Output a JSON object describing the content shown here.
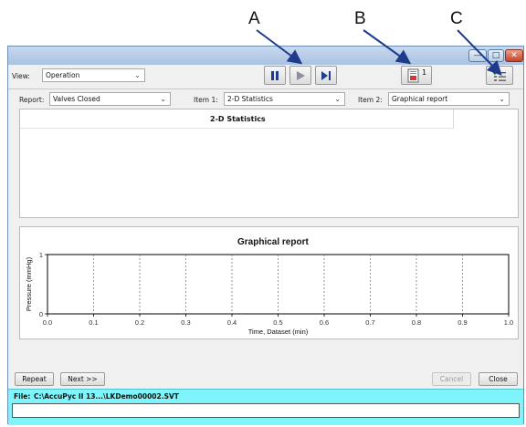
{
  "callouts": {
    "a": "A",
    "b": "B",
    "c": "C"
  },
  "window": {
    "titlebar_buttons": [
      "minimize",
      "maximize",
      "close"
    ]
  },
  "toolbar": {
    "view_label": "View:",
    "view_value": "Operation",
    "pause_icon": "pause-icon",
    "play_icon": "play-icon",
    "step_icon": "step-forward-icon",
    "report_badge": "1"
  },
  "selectors": {
    "report_label": "Report:",
    "report_value": "Valves Closed",
    "item1_label": "Item 1:",
    "item1_value": "2-D Statistics",
    "item2_label": "Item 2:",
    "item2_value": "Graphical report"
  },
  "stats_panel": {
    "title": "2-D Statistics"
  },
  "chart_data": {
    "type": "line",
    "title": "Graphical report",
    "xlabel": "Time, Dataset (min)",
    "ylabel": "Pressure (mmHg)",
    "xlim": [
      0.0,
      1.0
    ],
    "ylim": [
      0,
      1
    ],
    "x_ticks": [
      "0.0",
      "0.1",
      "0.2",
      "0.3",
      "0.4",
      "0.5",
      "0.6",
      "0.7",
      "0.8",
      "0.9",
      "1.0"
    ],
    "y_ticks": [
      "0",
      "1"
    ],
    "series": [],
    "grid": "vertical dashed"
  },
  "footer": {
    "repeat": "Repeat",
    "next": "Next >>",
    "cancel": "Cancel",
    "close": "Close"
  },
  "filebar": {
    "label": "File:",
    "path": "C:\\AccuPyc II 13...\\LKDemo00002.SVT"
  }
}
